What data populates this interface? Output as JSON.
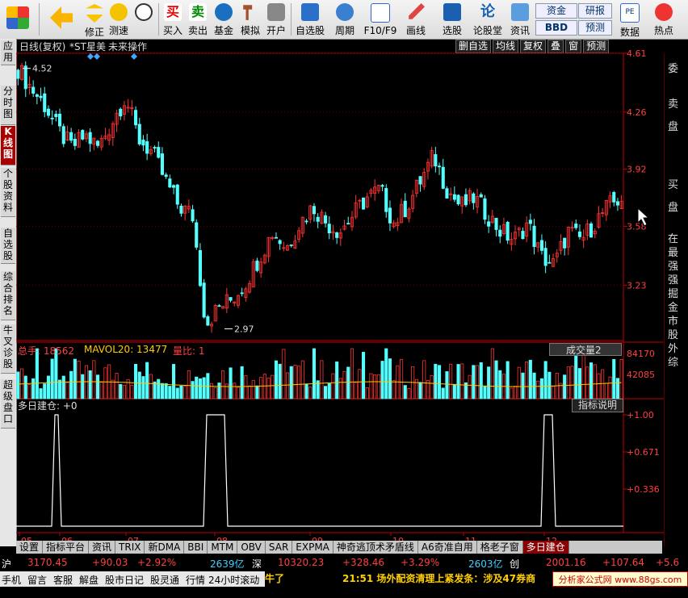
{
  "toolbar": {
    "buttons": [
      {
        "label": "",
        "icon": "windows-logo-icon"
      },
      {
        "label": "",
        "icon": "back-arrow-icon"
      },
      {
        "label": "修正",
        "icon": "up-down-arrow-icon"
      },
      {
        "label": "测速",
        "icon": "speed-icon"
      },
      {
        "label": "",
        "icon": "clock-icon"
      },
      {
        "label": "买入",
        "icon": "buy-icon"
      },
      {
        "label": "卖出",
        "icon": "sell-icon"
      },
      {
        "label": "基金",
        "icon": "fund-icon"
      },
      {
        "label": "模拟",
        "icon": "hammer-icon"
      },
      {
        "label": "开户",
        "icon": "lock-icon"
      },
      {
        "label": "自选股",
        "icon": "star-icon"
      },
      {
        "label": "周期",
        "icon": "cycle-icon"
      },
      {
        "label": "F10/F9",
        "icon": "f10-icon"
      },
      {
        "label": "画线",
        "icon": "pen-icon"
      },
      {
        "label": "选股",
        "icon": "chart-select-icon"
      },
      {
        "label": "论股堂",
        "icon": "forum-icon"
      },
      {
        "label": "资讯",
        "icon": "info-icon"
      },
      {
        "label": "数据",
        "icon": "pe-icon"
      },
      {
        "label": "热点",
        "icon": "hot-icon"
      }
    ],
    "fund_label": "资金",
    "research_label": "研报",
    "bbd_label": "BBD",
    "forecast_label": "预测",
    "buy_badge": "买",
    "sell_badge": "卖"
  },
  "side_tabs": [
    "应用",
    "分时图",
    "K线图",
    "个股资料",
    "自选股",
    "综合排名",
    "牛叉诊股",
    "超级盘口"
  ],
  "header": {
    "title": "日线(复权)",
    "stock": "*ST星美",
    "note": "未来操作",
    "mini_tabs": [
      "删自选",
      "均线",
      "复权",
      "叠",
      "窗",
      "预测"
    ]
  },
  "price_labels": [
    "4.61",
    "4.26",
    "3.92",
    "3.58",
    "3.23"
  ],
  "high_mark": "4.52",
  "low_mark": "2.97",
  "volume": {
    "label1": "总手: 18562",
    "label2": "MAVOL20: 13477",
    "label3": "量比: 1",
    "selector": "成交量2",
    "axis": [
      "84170",
      "42085"
    ]
  },
  "indicator": {
    "title": "多日建仓: +0",
    "help_button": "指标说明",
    "axis": [
      "+1.00",
      "+0.671",
      "+0.336"
    ]
  },
  "months": [
    "05",
    "06",
    "07",
    "08",
    "09",
    "10",
    "11",
    "12"
  ],
  "bottom_tabs": [
    "设置",
    "指标平台",
    "资讯",
    "TRIX",
    "新DMA",
    "BBI",
    "MTM",
    "OBV",
    "SAR",
    "EXPMA",
    "神奇逃顶术矛盾线",
    "A6奇准自用",
    "格老子窗",
    "多日建仓"
  ],
  "right_panel": {
    "sell": "卖盘",
    "buy": "买盘",
    "committee": "委",
    "news": "在最强强掘金市股外综"
  },
  "status1": {
    "sh_label": "沪",
    "sh_value": "3170.45",
    "sh_change": "+90.03",
    "sh_pct": "+2.92%",
    "sh_amount": "2639亿",
    "sz_label": "深",
    "sz_value": "10320.23",
    "sz_change": "+328.46",
    "sz_pct": "+3.29%",
    "sz_amount": "2603亿",
    "cy_label": "创",
    "cy_value": "2001.16",
    "cy_change": "+107.64",
    "cy_pct": "+5.6"
  },
  "status2": {
    "items": [
      "手机",
      "留言",
      "客服",
      "解盘",
      "股市日记",
      "股灵通",
      "行情",
      "24小时滚动"
    ],
    "ticker_left": "牛了",
    "ticker": "21:51 场外配资清理上紧发条：涉及47券商",
    "brand": "分析家公式网 www.88gs.com"
  },
  "colors": {
    "up": "#ff3333",
    "down": "#54ffff",
    "axis_red": "#c00000",
    "text_red": "#ff4040",
    "bg": "#000000"
  },
  "chart_data": {
    "type": "line",
    "title": "日线(复权)",
    "series": [
      {
        "values": [
          4.52,
          4.4,
          4.3,
          4.15,
          4.05,
          4.12,
          4.05,
          4.2,
          4.35,
          4.1,
          4.02,
          3.85,
          3.7,
          3.65,
          3.0,
          3.1,
          3.15,
          3.25,
          3.4,
          3.55,
          3.45,
          3.6,
          3.7,
          3.6,
          3.55,
          3.65,
          3.75,
          3.8,
          3.6,
          3.7,
          3.85,
          4.0,
          3.8,
          3.7,
          3.75,
          3.65,
          3.55,
          3.5,
          3.6,
          3.4,
          3.35,
          3.55,
          3.5,
          3.6,
          3.7,
          3.75
        ]
      }
    ],
    "ylim": [
      2.9,
      4.61
    ]
  }
}
